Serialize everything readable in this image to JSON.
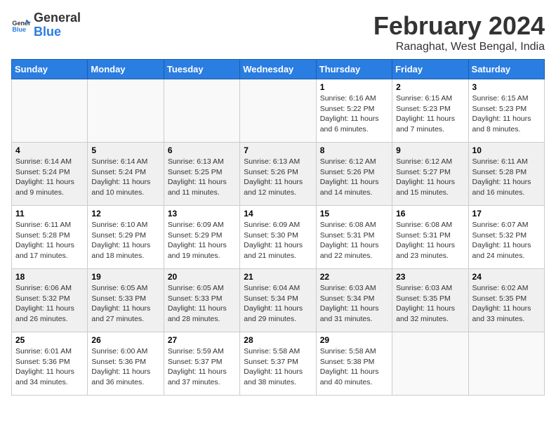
{
  "logo": {
    "line1": "General",
    "line2": "Blue"
  },
  "title": "February 2024",
  "subtitle": "Ranaghat, West Bengal, India",
  "days_of_week": [
    "Sunday",
    "Monday",
    "Tuesday",
    "Wednesday",
    "Thursday",
    "Friday",
    "Saturday"
  ],
  "weeks": [
    [
      {
        "day": "",
        "info": ""
      },
      {
        "day": "",
        "info": ""
      },
      {
        "day": "",
        "info": ""
      },
      {
        "day": "",
        "info": ""
      },
      {
        "day": "1",
        "info": "Sunrise: 6:16 AM\nSunset: 5:22 PM\nDaylight: 11 hours\nand 6 minutes."
      },
      {
        "day": "2",
        "info": "Sunrise: 6:15 AM\nSunset: 5:23 PM\nDaylight: 11 hours\nand 7 minutes."
      },
      {
        "day": "3",
        "info": "Sunrise: 6:15 AM\nSunset: 5:23 PM\nDaylight: 11 hours\nand 8 minutes."
      }
    ],
    [
      {
        "day": "4",
        "info": "Sunrise: 6:14 AM\nSunset: 5:24 PM\nDaylight: 11 hours\nand 9 minutes."
      },
      {
        "day": "5",
        "info": "Sunrise: 6:14 AM\nSunset: 5:24 PM\nDaylight: 11 hours\nand 10 minutes."
      },
      {
        "day": "6",
        "info": "Sunrise: 6:13 AM\nSunset: 5:25 PM\nDaylight: 11 hours\nand 11 minutes."
      },
      {
        "day": "7",
        "info": "Sunrise: 6:13 AM\nSunset: 5:26 PM\nDaylight: 11 hours\nand 12 minutes."
      },
      {
        "day": "8",
        "info": "Sunrise: 6:12 AM\nSunset: 5:26 PM\nDaylight: 11 hours\nand 14 minutes."
      },
      {
        "day": "9",
        "info": "Sunrise: 6:12 AM\nSunset: 5:27 PM\nDaylight: 11 hours\nand 15 minutes."
      },
      {
        "day": "10",
        "info": "Sunrise: 6:11 AM\nSunset: 5:28 PM\nDaylight: 11 hours\nand 16 minutes."
      }
    ],
    [
      {
        "day": "11",
        "info": "Sunrise: 6:11 AM\nSunset: 5:28 PM\nDaylight: 11 hours\nand 17 minutes."
      },
      {
        "day": "12",
        "info": "Sunrise: 6:10 AM\nSunset: 5:29 PM\nDaylight: 11 hours\nand 18 minutes."
      },
      {
        "day": "13",
        "info": "Sunrise: 6:09 AM\nSunset: 5:29 PM\nDaylight: 11 hours\nand 19 minutes."
      },
      {
        "day": "14",
        "info": "Sunrise: 6:09 AM\nSunset: 5:30 PM\nDaylight: 11 hours\nand 21 minutes."
      },
      {
        "day": "15",
        "info": "Sunrise: 6:08 AM\nSunset: 5:31 PM\nDaylight: 11 hours\nand 22 minutes."
      },
      {
        "day": "16",
        "info": "Sunrise: 6:08 AM\nSunset: 5:31 PM\nDaylight: 11 hours\nand 23 minutes."
      },
      {
        "day": "17",
        "info": "Sunrise: 6:07 AM\nSunset: 5:32 PM\nDaylight: 11 hours\nand 24 minutes."
      }
    ],
    [
      {
        "day": "18",
        "info": "Sunrise: 6:06 AM\nSunset: 5:32 PM\nDaylight: 11 hours\nand 26 minutes."
      },
      {
        "day": "19",
        "info": "Sunrise: 6:05 AM\nSunset: 5:33 PM\nDaylight: 11 hours\nand 27 minutes."
      },
      {
        "day": "20",
        "info": "Sunrise: 6:05 AM\nSunset: 5:33 PM\nDaylight: 11 hours\nand 28 minutes."
      },
      {
        "day": "21",
        "info": "Sunrise: 6:04 AM\nSunset: 5:34 PM\nDaylight: 11 hours\nand 29 minutes."
      },
      {
        "day": "22",
        "info": "Sunrise: 6:03 AM\nSunset: 5:34 PM\nDaylight: 11 hours\nand 31 minutes."
      },
      {
        "day": "23",
        "info": "Sunrise: 6:03 AM\nSunset: 5:35 PM\nDaylight: 11 hours\nand 32 minutes."
      },
      {
        "day": "24",
        "info": "Sunrise: 6:02 AM\nSunset: 5:35 PM\nDaylight: 11 hours\nand 33 minutes."
      }
    ],
    [
      {
        "day": "25",
        "info": "Sunrise: 6:01 AM\nSunset: 5:36 PM\nDaylight: 11 hours\nand 34 minutes."
      },
      {
        "day": "26",
        "info": "Sunrise: 6:00 AM\nSunset: 5:36 PM\nDaylight: 11 hours\nand 36 minutes."
      },
      {
        "day": "27",
        "info": "Sunrise: 5:59 AM\nSunset: 5:37 PM\nDaylight: 11 hours\nand 37 minutes."
      },
      {
        "day": "28",
        "info": "Sunrise: 5:58 AM\nSunset: 5:37 PM\nDaylight: 11 hours\nand 38 minutes."
      },
      {
        "day": "29",
        "info": "Sunrise: 5:58 AM\nSunset: 5:38 PM\nDaylight: 11 hours\nand 40 minutes."
      },
      {
        "day": "",
        "info": ""
      },
      {
        "day": "",
        "info": ""
      }
    ]
  ]
}
